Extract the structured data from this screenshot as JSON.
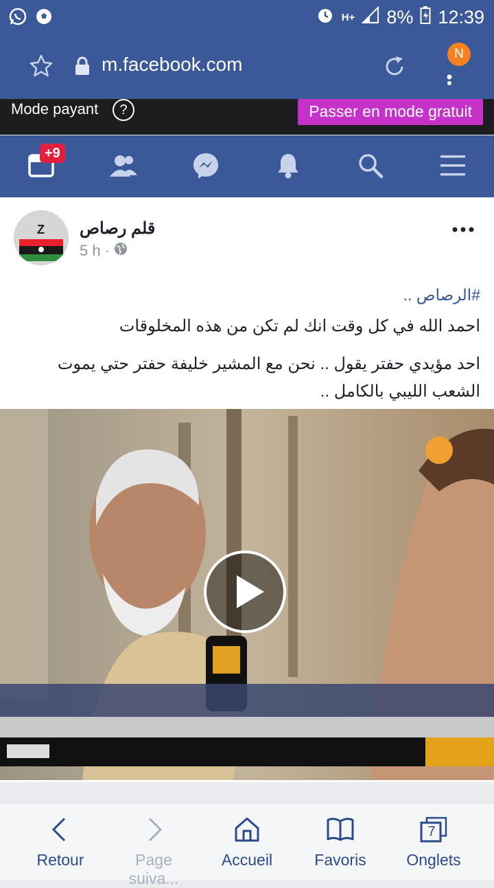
{
  "status_bar": {
    "left_icons": [
      "whatsapp-icon",
      "soccer-ball-icon"
    ],
    "network": "H+",
    "battery": "8%",
    "time": "12:39"
  },
  "browser": {
    "url": "m.facebook.com",
    "profile_badge": "N"
  },
  "data_mode": {
    "label": "Mode payant",
    "help": "?",
    "upgrade_button": "Passer en mode gratuit"
  },
  "fb_nav": {
    "news_badge": "+9",
    "tabs": [
      "news-feed-icon",
      "friends-icon",
      "messenger-icon",
      "notifications-icon",
      "search-icon",
      "menu-icon"
    ]
  },
  "post": {
    "author": "قلم رصاص",
    "time": "5 h",
    "separator": "·",
    "hashtag": "#الرصاص",
    "hashtag_suffix": " ..",
    "line1": "احمد الله في كل وقت انك لم تكن من هذه المخلوقات",
    "line2": "احد مؤيدي حفتر يقول .. نحن مع المشير خليفة حفتر حتي يموت الشعب الليبي بالكامل .."
  },
  "bottom_nav": {
    "back": "Retour",
    "forward": "Page suiva...",
    "home": "Accueil",
    "bookmarks": "Favoris",
    "tabs": "Onglets",
    "tab_count": "7"
  },
  "colors": {
    "facebook_blue": "#3b5998",
    "upgrade_purple": "#c532c9",
    "badge_red": "#e41e3f",
    "profile_orange": "#f5821f"
  }
}
